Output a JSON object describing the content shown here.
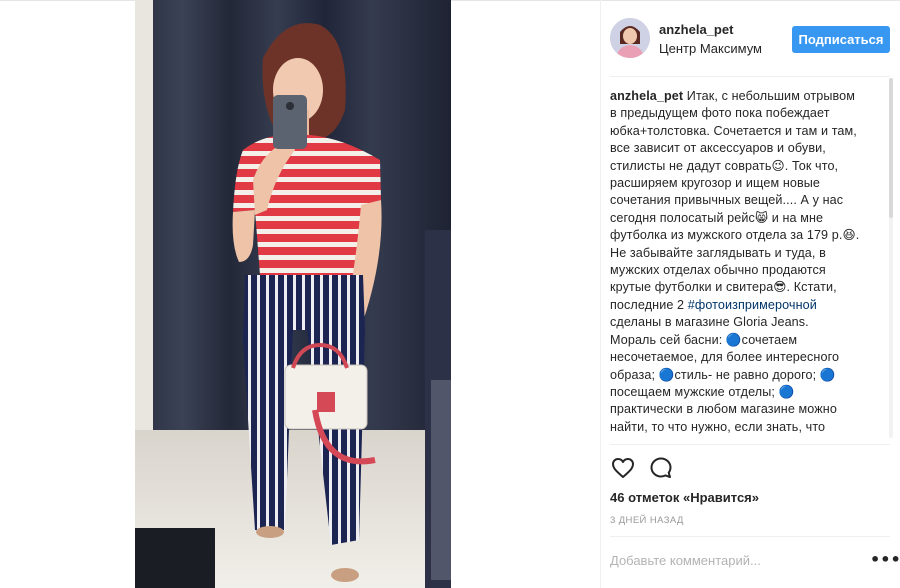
{
  "post": {
    "username": "anzhela_pet",
    "location": "Центр Максимум",
    "follow_label": "Подписаться",
    "caption": {
      "lines": [
        [
          {
            "t": "anzhela_pet",
            "k": "uname"
          },
          {
            "t": " Итак, с небольшим отрывом",
            "k": "text"
          }
        ],
        [
          {
            "t": "в предыдущем фото пока побеждает",
            "k": "text"
          }
        ],
        [
          {
            "t": "юбка+толстовка. Сочетается и там и там,",
            "k": "text"
          }
        ],
        [
          {
            "t": "все зависит от аксессуаров и обуви,",
            "k": "text"
          }
        ],
        [
          {
            "t": "стилисты не дадут соврать😉. Ток что,",
            "k": "text"
          }
        ],
        [
          {
            "t": "расширяем кругозор и ищем новые",
            "k": "text"
          }
        ],
        [
          {
            "t": "сочетания привычных вещей.... А у нас",
            "k": "text"
          }
        ],
        [
          {
            "t": "сегодня полосатый рейс😸 и на мне",
            "k": "text"
          }
        ],
        [
          {
            "t": "футболка из мужского отдела за 179 р.😆.",
            "k": "text"
          }
        ],
        [
          {
            "t": "Не забывайте заглядывать и туда, в",
            "k": "text"
          }
        ],
        [
          {
            "t": "мужских отделах обычно продаются",
            "k": "text"
          }
        ],
        [
          {
            "t": "крутые футболки и свитера😎. Кстати,",
            "k": "text"
          }
        ],
        [
          {
            "t": "последние 2 ",
            "k": "text"
          },
          {
            "t": "#фотоизпримерочной",
            "k": "tag"
          }
        ],
        [
          {
            "t": "сделаны в магазине Gloria Jeans.",
            "k": "text"
          }
        ],
        [
          {
            "t": "Мораль сей басни: 🔵сочетаем",
            "k": "text"
          }
        ],
        [
          {
            "t": "несочетаемое, для более интересного",
            "k": "text"
          }
        ],
        [
          {
            "t": "образа; 🔵стиль- не равно дорого; 🔵",
            "k": "text"
          }
        ],
        [
          {
            "t": "посещаем мужские отделы; 🔵",
            "k": "text"
          }
        ],
        [
          {
            "t": "практически в любом магазине можно",
            "k": "text"
          }
        ],
        [
          {
            "t": "найти, то что нужно, если знать, что",
            "k": "text"
          }
        ]
      ]
    },
    "likes_text": "46 отметок «Нравится»",
    "time_text": "3 ДНЕЙ НАЗАД",
    "comment_placeholder": "Добавьте комментарий...",
    "more_label": "•••",
    "icons": {
      "like": "heart-icon",
      "comment": "comment-bubble-icon",
      "more": "more-options-icon"
    },
    "colors": {
      "follow_button": "#3897f0",
      "hashtag": "#003569",
      "muted": "#999999"
    }
  }
}
